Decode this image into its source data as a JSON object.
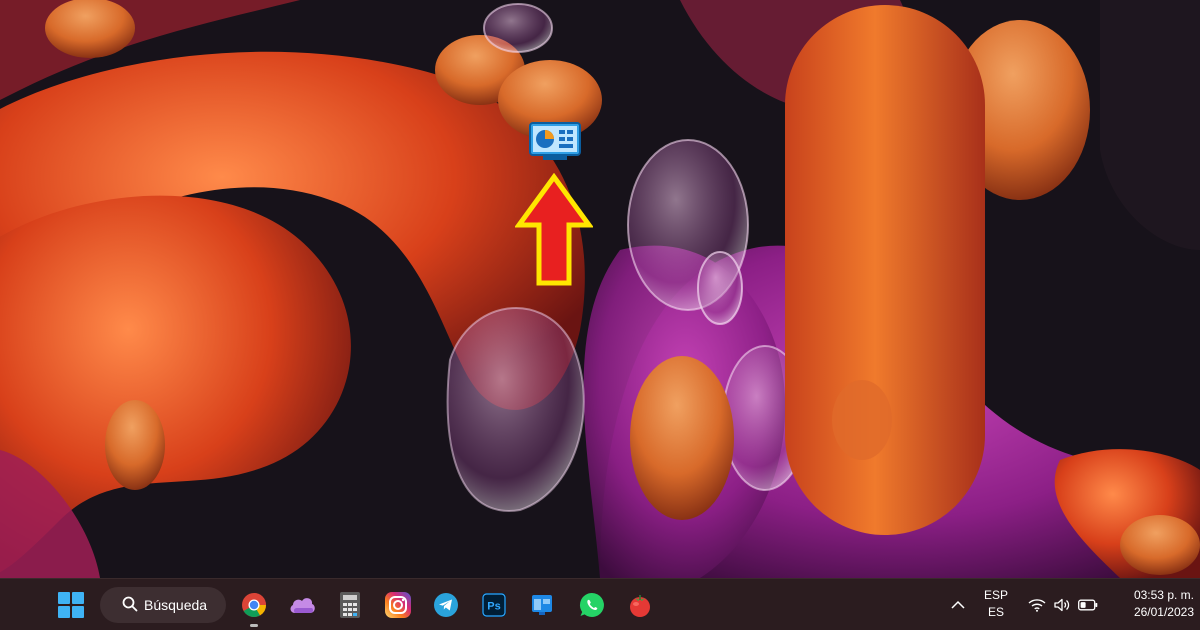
{
  "desktop": {
    "icon_name": "control-panel-icon",
    "annotation": "red-arrow-up-icon"
  },
  "taskbar": {
    "start": "windows-start-icon",
    "search": {
      "label": "Búsqueda",
      "icon": "search-icon"
    },
    "apps": [
      {
        "name": "chrome-icon",
        "running": true
      },
      {
        "name": "cloud-app-icon",
        "running": false
      },
      {
        "name": "calculator-icon",
        "running": false
      },
      {
        "name": "instagram-icon",
        "running": false
      },
      {
        "name": "telegram-icon",
        "running": false
      },
      {
        "name": "photoshop-icon",
        "running": false
      },
      {
        "name": "app-window-icon",
        "running": false
      },
      {
        "name": "whatsapp-icon",
        "running": false
      },
      {
        "name": "tomato-timer-icon",
        "running": false
      }
    ],
    "tray": {
      "chevron": "chevron-up-icon",
      "language_top": "ESP",
      "language_bottom": "ES",
      "wifi": "wifi-icon",
      "volume": "volume-icon",
      "battery": "battery-icon",
      "time": "03:53 p. m.",
      "date": "26/01/2023"
    }
  },
  "colors": {
    "taskbar_bg": "#2b1c1f",
    "wallpaper_dark": "#17121a",
    "wallpaper_orange": "#e2521c",
    "wallpaper_magenta": "#a0258f",
    "arrow_red": "#e82020",
    "arrow_yellow": "#ffe600"
  }
}
